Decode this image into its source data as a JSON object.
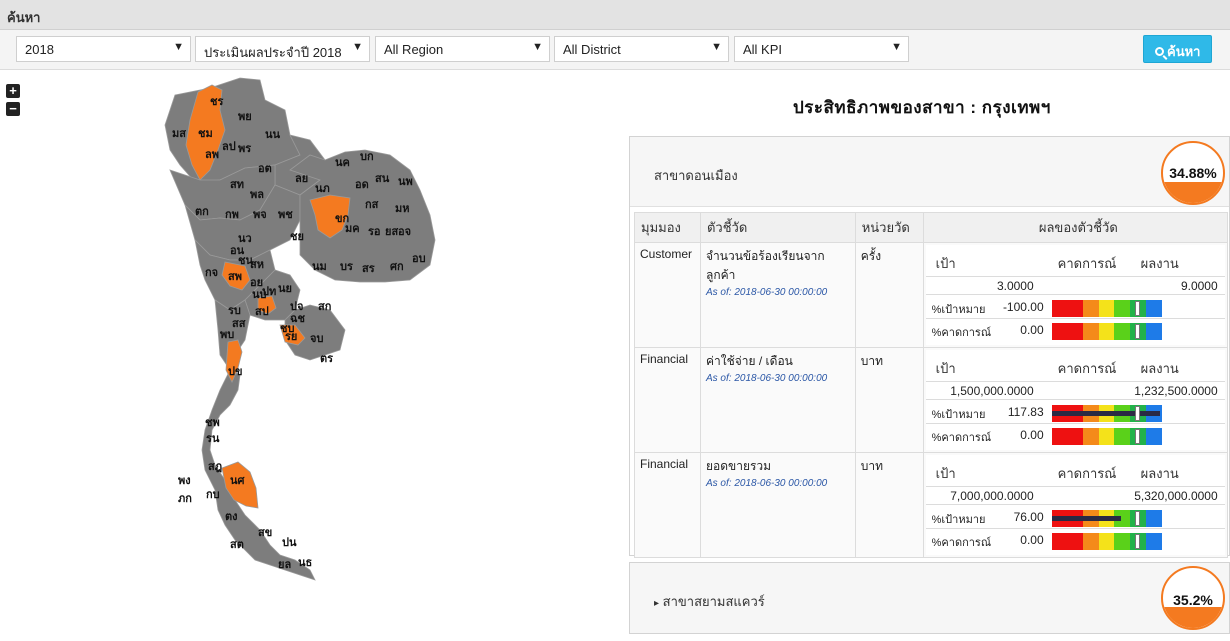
{
  "topbar": {
    "title": "ค้นหา"
  },
  "filters": {
    "year": "2018",
    "evaluation": "ประเมินผลประจำปี 2018",
    "region": "All Region",
    "district": "All District",
    "kpi": "All KPI",
    "search_label": "ค้นหา"
  },
  "map": {
    "zoom_in": "+",
    "zoom_out": "−",
    "labels": [
      "ชร",
      "พย",
      "มส",
      "ชม",
      "ลพ",
      "ลป",
      "พร",
      "นน",
      "อต",
      "สท",
      "ตก",
      "พล",
      "กพ",
      "พจ",
      "พช",
      "นว",
      "อน",
      "ชน",
      "สห",
      "กจ",
      "สพ",
      "อย",
      "นบ",
      "ปท",
      "นย",
      "ปจ",
      "ฉช",
      "สก",
      "รบ",
      "สส",
      "สป",
      "พบ",
      "ชบ",
      "รย",
      "จบ",
      "ตร",
      "ปข",
      "ชพ",
      "รน",
      "สฎ",
      "นศ",
      "พง",
      "ภก",
      "กบ",
      "ตง",
      "สข",
      "สต",
      "ปน",
      "ยล",
      "นธ",
      "นค",
      "บก",
      "สน",
      "นพ",
      "อด",
      "ลย",
      "นภ",
      "ขก",
      "กส",
      "มห",
      "ชย",
      "มค",
      "รอ",
      "ยส",
      "อจ",
      "บร",
      "นม",
      "สร",
      "ศก",
      "อบ"
    ],
    "highlight_color": "#f47a20",
    "base_color": "#7d7d7d"
  },
  "page_title": "ประสิทธิภาพของสาขา : กรุงเทพฯ",
  "branch1": {
    "name": "สาขาดอนเมือง",
    "percent_text": "34.88%",
    "percent": 34.88,
    "headers": {
      "perspective": "มุมมอง",
      "indicator": "ตัวชี้วัด",
      "unit": "หน่วยวัด",
      "result": "ผลของตัวชี้วัด"
    },
    "result_headers": {
      "target": "เป้า",
      "forecast": "คาดการณ์",
      "actual": "ผลงาน"
    },
    "pct_target_label": "%เป้าหมาย",
    "pct_forecast_label": "%คาดการณ์",
    "rows": [
      {
        "perspective": "Customer",
        "indicator": "จำนวนข้อร้องเรียนจากลูกค้า",
        "asof": "As of: 2018-06-30 00:00:00",
        "unit": "ครั้ง",
        "target": "3.0000",
        "forecast": "",
        "actual": "9.0000",
        "pct_target": "-100.00",
        "pct_forecast": "0.00",
        "pct_target_value": -100.0,
        "pct_forecast_value": 0.0
      },
      {
        "perspective": "Financial",
        "indicator": "ค่าใช้จ่าย / เดือน",
        "asof": "As of: 2018-06-30 00:00:00",
        "unit": "บาท",
        "target": "1,500,000.0000",
        "forecast": "",
        "actual": "1,232,500.0000",
        "pct_target": "117.83",
        "pct_forecast": "0.00",
        "pct_target_value": 117.83,
        "pct_forecast_value": 0.0
      },
      {
        "perspective": "Financial",
        "indicator": "ยอดขายรวม",
        "asof": "As of: 2018-06-30 00:00:00",
        "unit": "บาท",
        "target": "7,000,000.0000",
        "forecast": "",
        "actual": "5,320,000.0000",
        "pct_target": "76.00",
        "pct_forecast": "0.00",
        "pct_target_value": 76.0,
        "pct_forecast_value": 0.0
      }
    ]
  },
  "branch2": {
    "name": "สาขาสยามสแควร์",
    "percent_text": "35.2%",
    "percent": 35.2,
    "caret": "▸"
  },
  "colors": {
    "accent_button": "#2fb9e8",
    "gauge_orange": "#f47a20",
    "link_blue": "#2b57a6"
  },
  "icons": {
    "dropdown": "caret-down-icon",
    "search": "search-icon",
    "expand": "caret-right-icon"
  }
}
